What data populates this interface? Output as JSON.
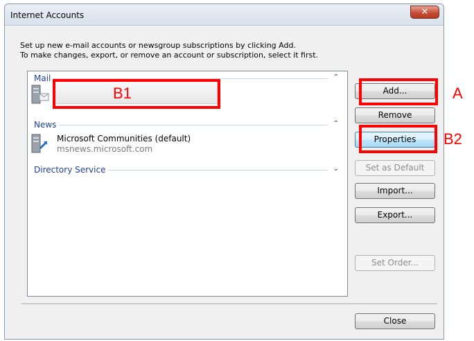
{
  "window": {
    "title": "Internet Accounts",
    "close_glyph": "✕"
  },
  "instructions": {
    "line1": "Set up new e-mail accounts or newsgroup subscriptions by clicking Add.",
    "line2": "To make changes, export, or remove an account or subscription, select it first."
  },
  "accounts_list": {
    "groups": [
      {
        "label": "Mail",
        "chevron": "⌃"
      },
      {
        "label": "News",
        "chevron": "⌃"
      },
      {
        "label": "Directory Service",
        "chevron": "⌄"
      }
    ],
    "news_account": {
      "name": "Microsoft Communities (default)",
      "server": "msnews.microsoft.com"
    }
  },
  "buttons": {
    "add": "Add...",
    "remove": "Remove",
    "properties": "Properties",
    "set_default": "Set as Default",
    "import": "Import...",
    "export": "Export...",
    "set_order": "Set Order...",
    "close": "Close"
  },
  "annotations": {
    "a": "A",
    "b1": "B1",
    "b2": "B2",
    "color": "#ff0000"
  }
}
